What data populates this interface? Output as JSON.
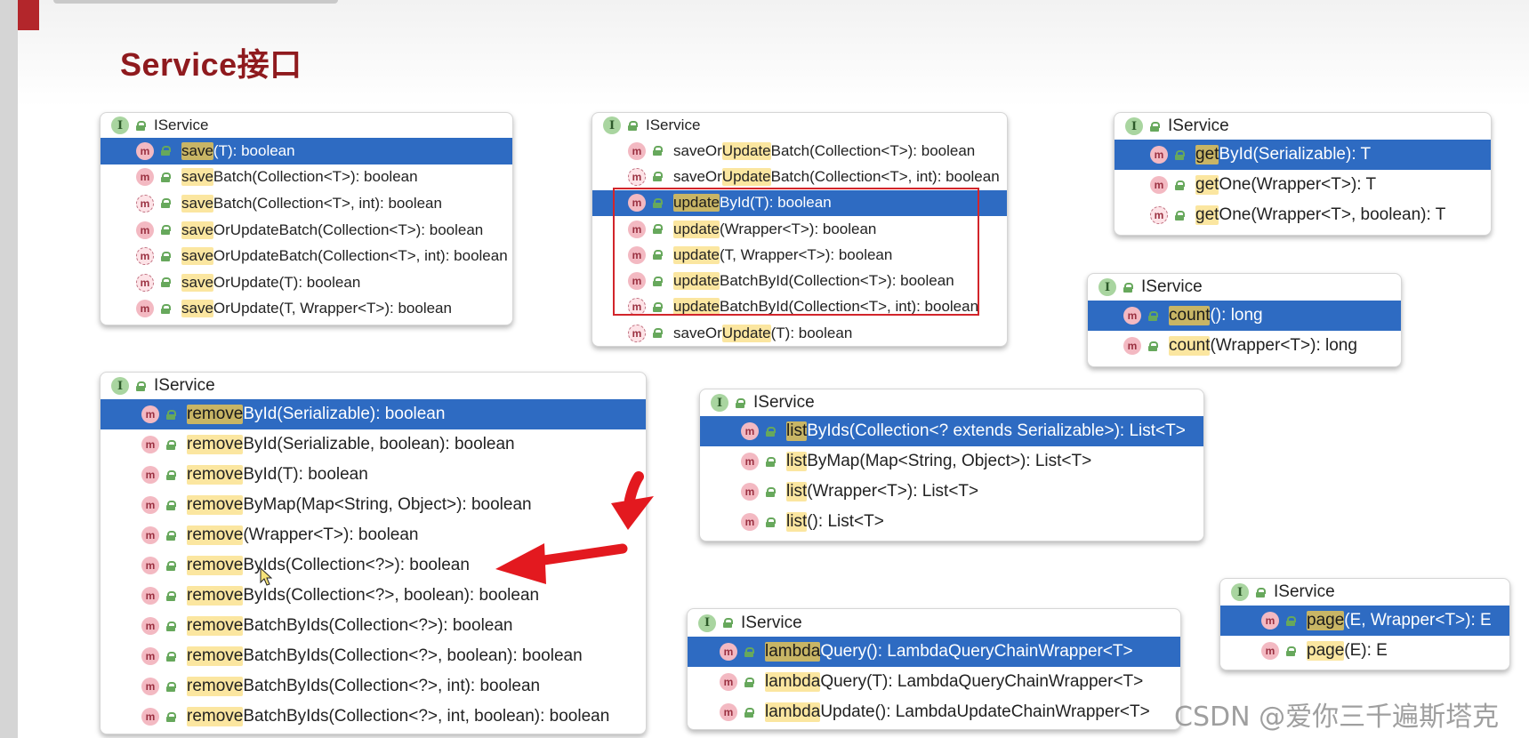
{
  "page": {
    "title": "Service接口",
    "watermark": "CSDN @爱你三千遍斯塔克"
  },
  "colors": {
    "accent": "#8f1a1e",
    "selection": "#2e6bc2",
    "match_highlight": "#fbe6a0",
    "annotation_red": "#d2252b"
  },
  "icons": {
    "interface": "interface-icon",
    "method": "method-icon",
    "access": "public-lock-icon"
  },
  "panels": [
    {
      "name": "save-popup",
      "header": "IService",
      "items": [
        {
          "prefix": "save",
          "rest": "(T): boolean",
          "abstract": false,
          "selected": true
        },
        {
          "prefix": "save",
          "rest": "Batch(Collection<T>): boolean",
          "abstract": false,
          "selected": false
        },
        {
          "prefix": "save",
          "rest": "Batch(Collection<T>, int): boolean",
          "abstract": true,
          "selected": false
        },
        {
          "prefix": "save",
          "rest": "OrUpdateBatch(Collection<T>): boolean",
          "abstract": false,
          "selected": false
        },
        {
          "prefix": "save",
          "rest": "OrUpdateBatch(Collection<T>, int): boolean",
          "abstract": true,
          "selected": false
        },
        {
          "prefix": "save",
          "rest": "OrUpdate(T): boolean",
          "abstract": true,
          "selected": false
        },
        {
          "prefix": "save",
          "rest": "OrUpdate(T, Wrapper<T>): boolean",
          "abstract": false,
          "selected": false
        }
      ]
    },
    {
      "name": "update-popup",
      "header": "IService",
      "items": [
        {
          "before": "saveOr",
          "prefix": "Update",
          "rest": "Batch(Collection<T>): boolean",
          "abstract": false,
          "selected": false
        },
        {
          "before": "saveOr",
          "prefix": "Update",
          "rest": "Batch(Collection<T>, int): boolean",
          "abstract": true,
          "selected": false
        },
        {
          "prefix": "update",
          "rest": "ById(T): boolean",
          "abstract": false,
          "selected": true
        },
        {
          "prefix": "update",
          "rest": "(Wrapper<T>): boolean",
          "abstract": false,
          "selected": false
        },
        {
          "prefix": "update",
          "rest": "(T, Wrapper<T>): boolean",
          "abstract": false,
          "selected": false
        },
        {
          "prefix": "update",
          "rest": "BatchById(Collection<T>): boolean",
          "abstract": false,
          "selected": false
        },
        {
          "prefix": "update",
          "rest": "BatchById(Collection<T>, int): boolean",
          "abstract": true,
          "selected": false
        },
        {
          "before": "saveOr",
          "prefix": "Update",
          "rest": "(T): boolean",
          "abstract": true,
          "selected": false
        }
      ]
    },
    {
      "name": "get-popup",
      "header": "IService",
      "items": [
        {
          "prefix": "get",
          "rest": "ById(Serializable): T",
          "abstract": false,
          "selected": true
        },
        {
          "prefix": "get",
          "rest": "One(Wrapper<T>): T",
          "abstract": false,
          "selected": false
        },
        {
          "prefix": "get",
          "rest": "One(Wrapper<T>, boolean): T",
          "abstract": true,
          "selected": false
        }
      ]
    },
    {
      "name": "count-popup",
      "header": "IService",
      "items": [
        {
          "prefix": "count",
          "rest": "(): long",
          "abstract": false,
          "selected": true
        },
        {
          "prefix": "count",
          "rest": "(Wrapper<T>): long",
          "abstract": false,
          "selected": false
        }
      ]
    },
    {
      "name": "remove-popup",
      "header": "IService",
      "items": [
        {
          "prefix": "remove",
          "rest": "ById(Serializable): boolean",
          "abstract": false,
          "selected": true
        },
        {
          "prefix": "remove",
          "rest": "ById(Serializable, boolean): boolean",
          "abstract": false,
          "selected": false
        },
        {
          "prefix": "remove",
          "rest": "ById(T): boolean",
          "abstract": false,
          "selected": false
        },
        {
          "prefix": "remove",
          "rest": "ByMap(Map<String, Object>): boolean",
          "abstract": false,
          "selected": false
        },
        {
          "prefix": "remove",
          "rest": "(Wrapper<T>): boolean",
          "abstract": false,
          "selected": false
        },
        {
          "prefix": "remove",
          "rest": "ByIds(Collection<?>): boolean",
          "abstract": false,
          "selected": false
        },
        {
          "prefix": "remove",
          "rest": "ByIds(Collection<?>, boolean): boolean",
          "abstract": false,
          "selected": false
        },
        {
          "prefix": "remove",
          "rest": "BatchByIds(Collection<?>): boolean",
          "abstract": false,
          "selected": false
        },
        {
          "prefix": "remove",
          "rest": "BatchByIds(Collection<?>, boolean): boolean",
          "abstract": false,
          "selected": false
        },
        {
          "prefix": "remove",
          "rest": "BatchByIds(Collection<?>, int): boolean",
          "abstract": false,
          "selected": false
        },
        {
          "prefix": "remove",
          "rest": "BatchByIds(Collection<?>, int, boolean): boolean",
          "abstract": false,
          "selected": false
        }
      ]
    },
    {
      "name": "list-popup",
      "header": "IService",
      "items": [
        {
          "prefix": "list",
          "rest": "ByIds(Collection<? extends Serializable>): List<T>",
          "abstract": false,
          "selected": true
        },
        {
          "prefix": "list",
          "rest": "ByMap(Map<String, Object>): List<T>",
          "abstract": false,
          "selected": false
        },
        {
          "prefix": "list",
          "rest": "(Wrapper<T>): List<T>",
          "abstract": false,
          "selected": false
        },
        {
          "prefix": "list",
          "rest": "(): List<T>",
          "abstract": false,
          "selected": false
        }
      ]
    },
    {
      "name": "lambda-popup",
      "header": "IService",
      "items": [
        {
          "prefix": "lambda",
          "rest": "Query(): LambdaQueryChainWrapper<T>",
          "abstract": false,
          "selected": true
        },
        {
          "prefix": "lambda",
          "rest": "Query(T): LambdaQueryChainWrapper<T>",
          "abstract": false,
          "selected": false
        },
        {
          "prefix": "lambda",
          "rest": "Update(): LambdaUpdateChainWrapper<T>",
          "abstract": false,
          "selected": false
        }
      ]
    },
    {
      "name": "page-popup",
      "header": "IService",
      "items": [
        {
          "prefix": "page",
          "rest": "(E, Wrapper<T>): E",
          "abstract": false,
          "selected": true
        },
        {
          "prefix": "page",
          "rest": "(E): E",
          "abstract": false,
          "selected": false
        }
      ]
    }
  ]
}
